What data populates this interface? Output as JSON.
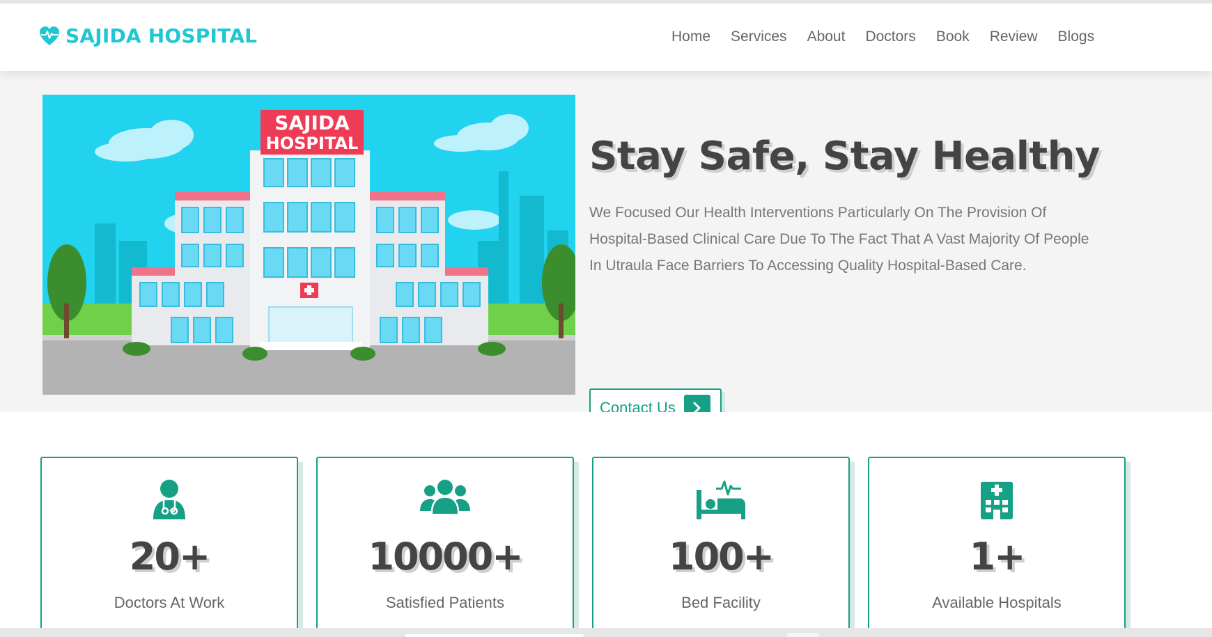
{
  "brand": {
    "name": "SAJIDA HOSPITAL",
    "icon": "heart-pulse-icon",
    "color": "#1fc7d3"
  },
  "nav": [
    {
      "label": "Home"
    },
    {
      "label": "Services"
    },
    {
      "label": "About"
    },
    {
      "label": "Doctors"
    },
    {
      "label": "Book"
    },
    {
      "label": "Review"
    },
    {
      "label": "Blogs"
    }
  ],
  "hero": {
    "title": "Stay Safe, Stay Healthy",
    "description": "We Focused Our Health Interventions Particularly On The Provision Of Hospital-Based Clinical Care Due To The Fact That A Vast Majority Of People In Utraula Face Barriers To Accessing Quality Hospital-Based Care.",
    "button_label": "Contact Us",
    "button_icon": "chevron-right-icon",
    "image_sign_line1": "SAJIDA",
    "image_sign_line2": "HOSPITAL"
  },
  "stats": [
    {
      "icon": "doctor-icon",
      "value": "20+",
      "label": "Doctors At Work"
    },
    {
      "icon": "users-icon",
      "value": "10000+",
      "label": "Satisfied Patients"
    },
    {
      "icon": "bed-pulse-icon",
      "value": "100+",
      "label": "Bed Facility"
    },
    {
      "icon": "hospital-icon",
      "value": "1+",
      "label": "Available Hospitals"
    }
  ],
  "colors": {
    "accent": "#16a085",
    "brand": "#1fc7d3",
    "heading": "#444444",
    "hero_bg": "#f4f4f4"
  }
}
